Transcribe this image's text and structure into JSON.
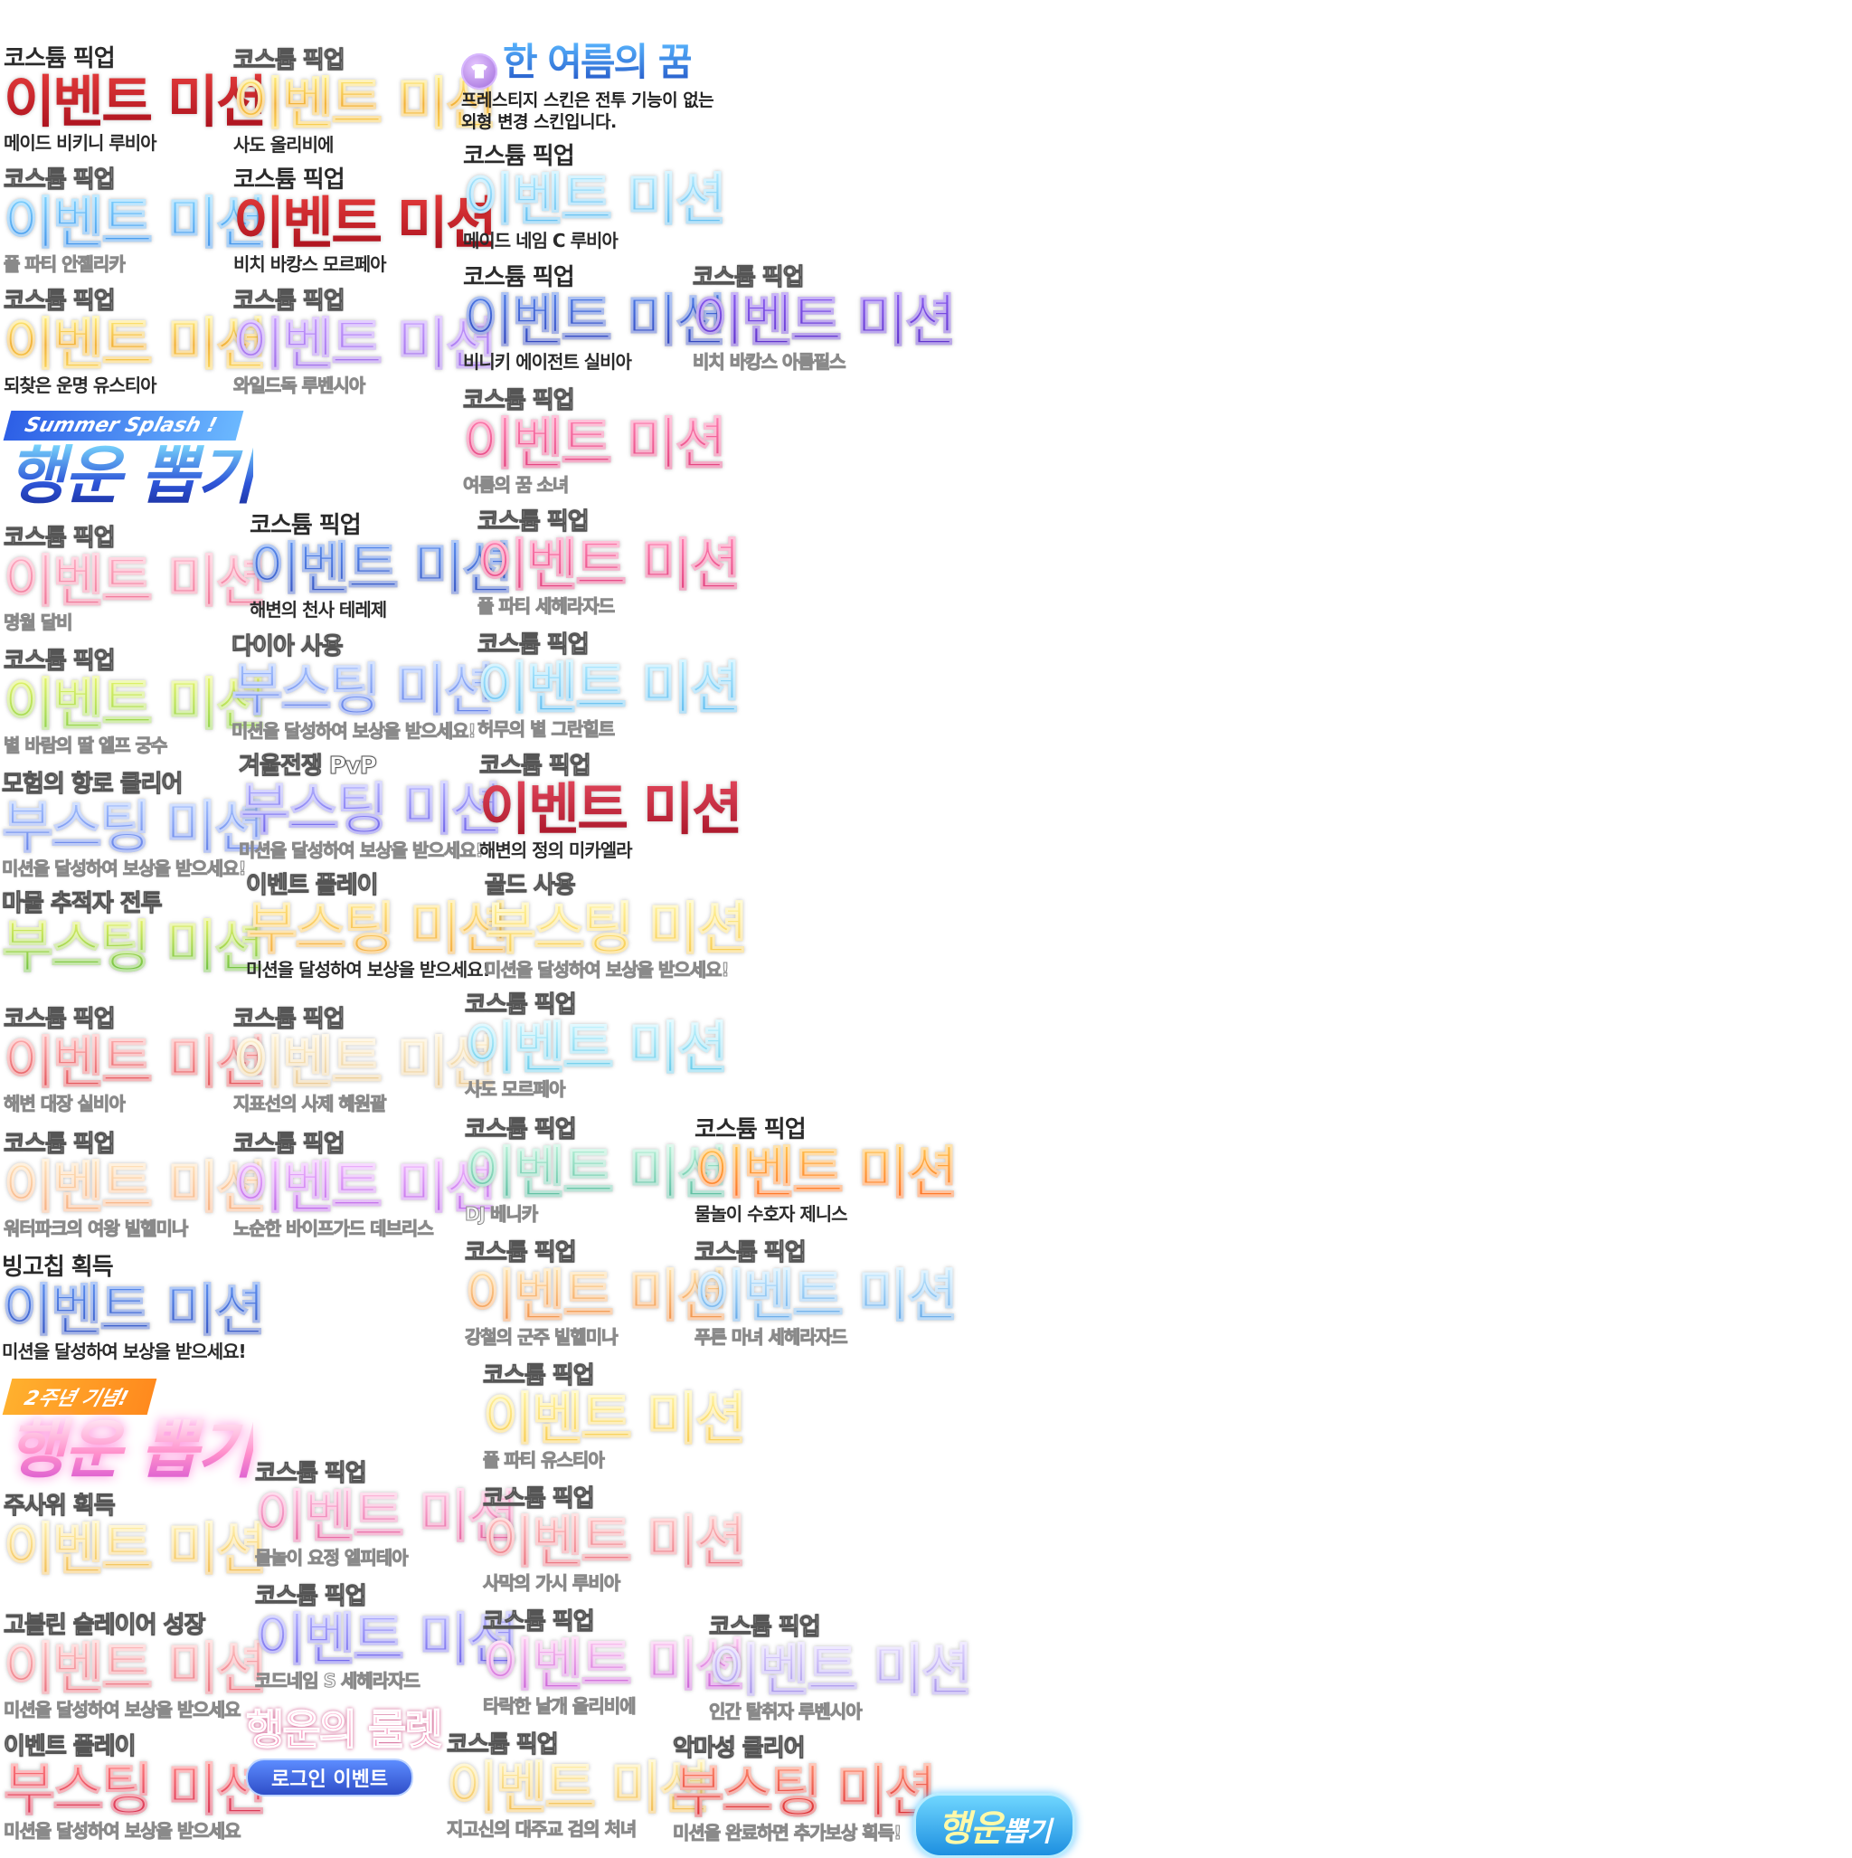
{
  "atlas": {
    "labels": {
      "costume": "코스튬 픽업",
      "event_mission": "이벤트 미션",
      "boost_mission": "부스팅 미션",
      "reward_desc": "미션을 달성하여 보상을 받으세요!",
      "reward_desc_short": "미션을 달성하여 보상을 받으세요"
    },
    "prestige": {
      "title": "한 여름의 꿈",
      "desc_line1": "프레스티지 스킨은 전투 기능이 없는",
      "desc_line2": "외형 변경 스킨입니다."
    },
    "summer_gacha": {
      "tag": "Summer Splash !",
      "title": "행운 뽑기"
    },
    "anniv_gacha": {
      "tag": "2주년 기념!",
      "title": "행운 뽑기"
    },
    "roulette": {
      "title": "행운의 룰렛",
      "button": "로그인 이벤트"
    },
    "gacha_button": {
      "word1": "행운",
      "word2": "뽑기"
    },
    "c0": {
      "r0": "메이드 비키니 루비아",
      "r1": "풀 파티 안젤리카",
      "r2": "되찾은 운명 유스티아",
      "r4": "명월 달비",
      "r5": "별 바람의 딸 엘프 궁수",
      "r6": {
        "sup": "모험의 항로 클리어"
      },
      "r7": {
        "sup": "마물 추적자 전투"
      },
      "r8": "해변 대장 실비아",
      "r9": "워터파크의 여왕 빌헬미나",
      "r10": {
        "sup": "빙고칩 획득"
      },
      "r11": {
        "sup": "주사위 획득"
      },
      "r12": {
        "sup": "고블린 슬레이어 성장"
      },
      "r13": {
        "sup": "이벤트 플레이"
      }
    },
    "c1": {
      "r0": "사도 올리비에",
      "r1": "비치 바캉스 모르페아",
      "r2": "와일드독 루벤시아",
      "r3": "해변의 천사 테레제",
      "r4": {
        "sup": "다이아 사용"
      },
      "r5": {
        "sup": "겨울전쟁 PvP"
      },
      "r6": {
        "sup": "이벤트 플레이"
      },
      "r7": "지표선의 사제 혜원괄",
      "r8": "노순한 바이프가드 데브리스",
      "r9": "물놀이 요정 엘피테아",
      "r10": "코드네임 S 세헤라자드"
    },
    "c2": {
      "r0": "메이드 네임 C 루비아",
      "r1": "비니키 에이전트 실비아",
      "r2": "여름의 꿈 소녀",
      "r3": "풀 파티 세헤라자드",
      "r4": "허무의 별 그란힐트",
      "r5": "해변의 정의 미카엘라",
      "r6": {
        "sup": "골드 사용"
      },
      "r7": "사도 모르페아",
      "r8": "DJ 베니카",
      "r9": "강철의 군주 빌헬미나",
      "r10": "풀 파티 유스티아",
      "r11": "사막의 가시 루비아",
      "r12": "타락한 날개 올리비에",
      "r13": "지고신의 대주교 검의 처녀"
    },
    "c3": {
      "r0": "비치 바캉스 아름필스",
      "r1": "물놀이 수호자 제니스",
      "r2": "푸른 마녀 세헤라자드",
      "r3": "인간 탈취자 루벤시아",
      "r4": {
        "sup": "악마성 클리어",
        "sub": "미션을 완료하면 추가보상 획득!"
      }
    }
  }
}
